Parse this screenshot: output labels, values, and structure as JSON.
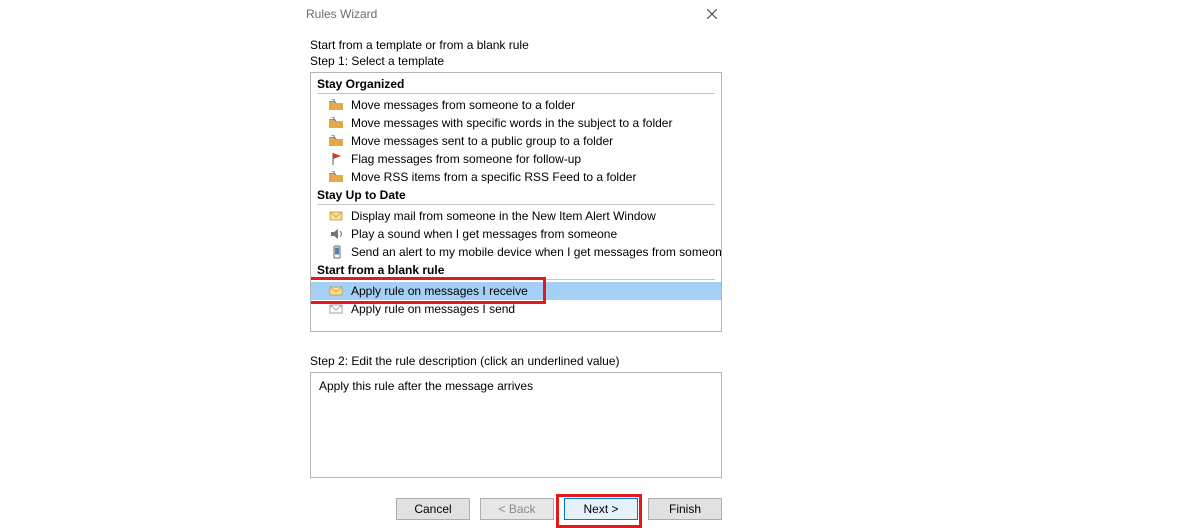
{
  "window": {
    "title": "Rules Wizard"
  },
  "intro": "Start from a template or from a blank rule",
  "step1_label": "Step 1: Select a template",
  "sections": {
    "organized": {
      "header": "Stay Organized",
      "items": [
        "Move messages from someone to a folder",
        "Move messages with specific words in the subject to a folder",
        "Move messages sent to a public group to a folder",
        "Flag messages from someone for follow-up",
        "Move RSS items from a specific RSS Feed to a folder"
      ]
    },
    "uptodate": {
      "header": "Stay Up to Date",
      "items": [
        "Display mail from someone in the New Item Alert Window",
        "Play a sound when I get messages from someone",
        "Send an alert to my mobile device when I get messages from someone"
      ]
    },
    "blank": {
      "header": "Start from a blank rule",
      "items": [
        "Apply rule on messages I receive",
        "Apply rule on messages I send"
      ]
    }
  },
  "step2_label": "Step 2: Edit the rule description (click an underlined value)",
  "description": "Apply this rule after the message arrives",
  "buttons": {
    "cancel": "Cancel",
    "back": "< Back",
    "next": "Next >",
    "finish": "Finish"
  }
}
